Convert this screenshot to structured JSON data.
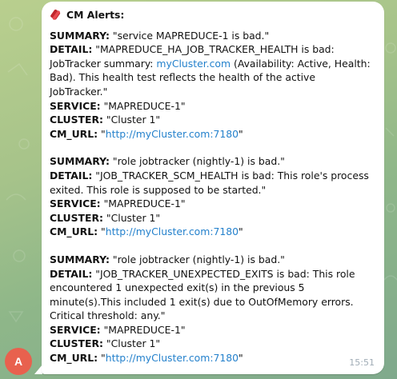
{
  "avatar": {
    "initial": "A",
    "color": "#e8614e"
  },
  "message": {
    "title": "CM Alerts:",
    "title_icon": "rolled-scroll-icon",
    "time": "15:51",
    "keys": {
      "summary": "SUMMARY:",
      "detail": "DETAIL:",
      "service": "SERVICE:",
      "cluster": "CLUSTER:",
      "cm_url": "CM_URL:"
    },
    "alerts": [
      {
        "summary": "\"service MAPREDUCE-1 is bad.\"",
        "detail_pre": "\"MAPREDUCE_HA_JOB_TRACKER_HEALTH is bad: JobTracker summary: ",
        "detail_link": "myCluster.com",
        "detail_post": " (Availability: Active, Health: Bad). This health test reflects the health of the active JobTracker.\"",
        "service": "\"MAPREDUCE-1\"",
        "cluster": "\"Cluster 1\"",
        "cm_url_open": "\"",
        "cm_url": "http://myCluster.com:7180",
        "cm_url_close": "\""
      },
      {
        "summary": "\"role jobtracker (nightly-1) is bad.\"",
        "detail": "\"JOB_TRACKER_SCM_HEALTH is bad: This role's process exited. This role is supposed to be started.\"",
        "service": "\"MAPREDUCE-1\"",
        "cluster": "\"Cluster 1\"",
        "cm_url_open": "\"",
        "cm_url": "http://myCluster.com:7180",
        "cm_url_close": "\""
      },
      {
        "summary": "\"role jobtracker (nightly-1) is bad.\"",
        "detail": "\"JOB_TRACKER_UNEXPECTED_EXITS is bad: This role encountered 1 unexpected exit(s) in the previous 5 minute(s).This included 1 exit(s) due to OutOfMemory errors. Critical threshold: any.\"",
        "service": "\"MAPREDUCE-1\"",
        "cluster": "\"Cluster 1\"",
        "cm_url_open": "\"",
        "cm_url": "http://myCluster.com:7180",
        "cm_url_close": "\""
      }
    ]
  },
  "colors": {
    "link": "#2481cc",
    "timestamp": "#a0acb6",
    "bubble": "#ffffff"
  }
}
